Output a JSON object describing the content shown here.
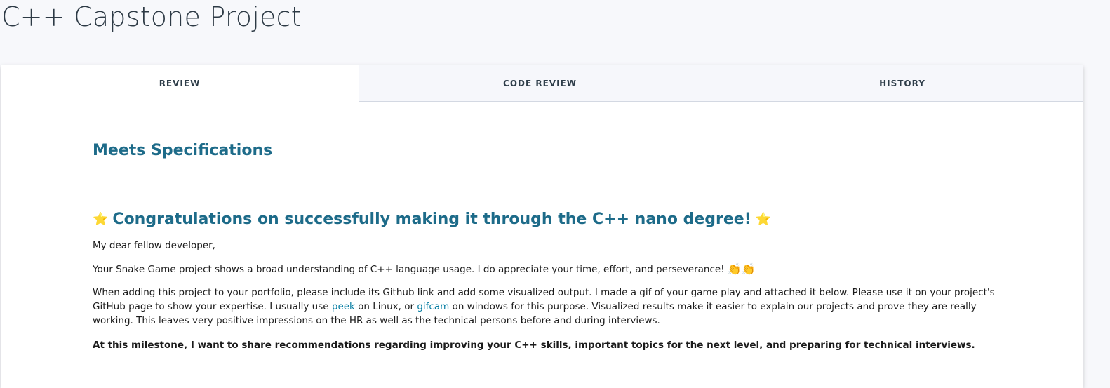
{
  "page": {
    "title": "C++ Capstone Project"
  },
  "tabs": [
    {
      "label": "REVIEW",
      "active": true
    },
    {
      "label": "CODE REVIEW",
      "active": false
    },
    {
      "label": "HISTORY",
      "active": false
    }
  ],
  "review": {
    "verdict": "Meets Specifications",
    "congrats_heading": "Congratulations on successfully making it through the C++ nano degree!",
    "greeting": "My dear fellow developer,",
    "praise": "Your Snake Game project shows a broad understanding of C++ language usage. I do appreciate your time, effort, and perseverance!",
    "portfolio": {
      "part1": "When adding this project to your portfolio, please include its Github link and add some visualized output. I made a gif of your game play and attached it below. Please use it on your project's GitHub page to show your expertise. I usually use ",
      "link1": "peek",
      "part2": " on Linux, or ",
      "link2": "gifcam",
      "part3": " on windows for this purpose. Visualized results make it easier to explain our projects and prove they are really working. This leaves very positive impressions on the HR as well as the technical persons before and during interviews."
    },
    "milestone": "At this milestone, I want to share recommendations regarding improving your C++ skills, important topics for the next level, and preparing for technical interviews."
  },
  "icons": {
    "star": "star-emoji-icon",
    "clap": "clapping-hands-icon",
    "accent_color": "#1d6b89",
    "link_color": "#077ea3",
    "star_color": "#f3c623"
  }
}
